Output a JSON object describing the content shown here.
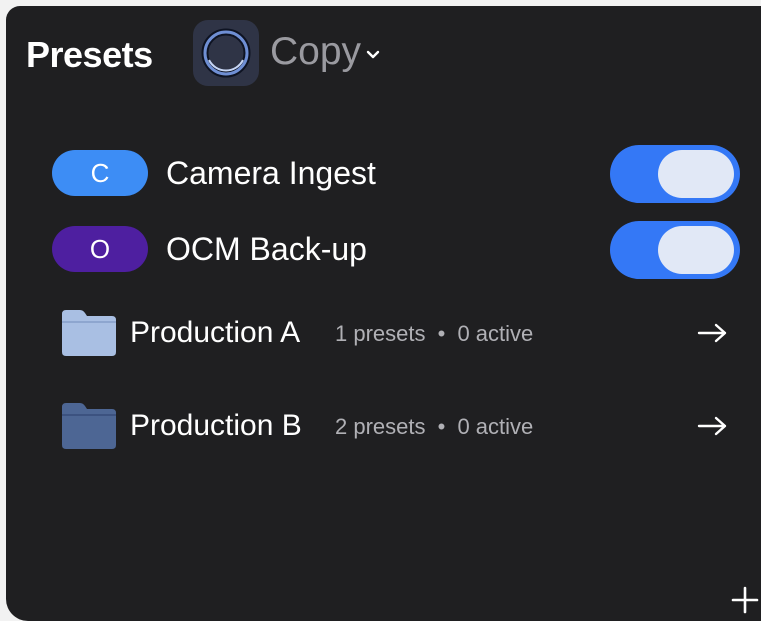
{
  "header": {
    "title": "Presets",
    "app_icon": "ring-logo-icon",
    "selector": {
      "label": "Copy",
      "icon": "chevron-down-icon"
    }
  },
  "presets": [
    {
      "badge": "C",
      "name": "Camera Ingest",
      "badge_color": "#3d8df5",
      "enabled": true
    },
    {
      "badge": "O",
      "name": "OCM Back-up",
      "badge_color": "#4e1fa0",
      "enabled": true
    }
  ],
  "folders": [
    {
      "name": "Production A",
      "presets": "1 presets",
      "separator": "•",
      "active": "0 active",
      "icon": "folder-icon",
      "color": "#a9bfe3"
    },
    {
      "name": "Production B",
      "presets": "2 presets",
      "separator": "•",
      "active": "0 active",
      "icon": "folder-icon",
      "color": "#4d6694"
    }
  ],
  "footer": {
    "add_icon": "plus-icon"
  },
  "colors": {
    "panel_bg": "#1f1f21",
    "toggle_on": "#3478f6"
  }
}
